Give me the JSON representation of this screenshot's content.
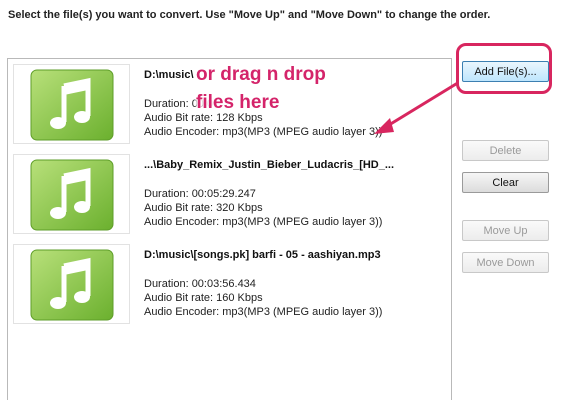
{
  "instruction": "Select the file(s) you want to convert. Use \"Move Up\" and \"Move Down\" to change the order.",
  "files": [
    {
      "name": "D:\\music\\",
      "duration": "Duration: 00:0",
      "bitrate": "Audio Bit rate: 128 Kbps",
      "encoder": "Audio Encoder: mp3(MP3 (MPEG audio layer 3))"
    },
    {
      "name": "...\\Baby_Remix_Justin_Bieber_Ludacris_[HD_...",
      "duration": "Duration: 00:05:29.247",
      "bitrate": "Audio Bit rate: 320 Kbps",
      "encoder": "Audio Encoder: mp3(MP3 (MPEG audio layer 3))"
    },
    {
      "name": "D:\\music\\[songs.pk] barfi - 05 - aashiyan.mp3",
      "duration": "Duration: 00:03:56.434",
      "bitrate": "Audio Bit rate: 160 Kbps",
      "encoder": "Audio Encoder: mp3(MP3 (MPEG audio layer 3))"
    }
  ],
  "buttons": {
    "add_files": "Add File(s)...",
    "delete": "Delete",
    "clear": "Clear",
    "move_up": "Move Up",
    "move_down": "Move Down"
  },
  "annotation": {
    "line1": "or drag n drop",
    "line2": "files here",
    "color": "#d4246a"
  },
  "icons": {
    "file_thumbnail": "music-note-icon"
  }
}
